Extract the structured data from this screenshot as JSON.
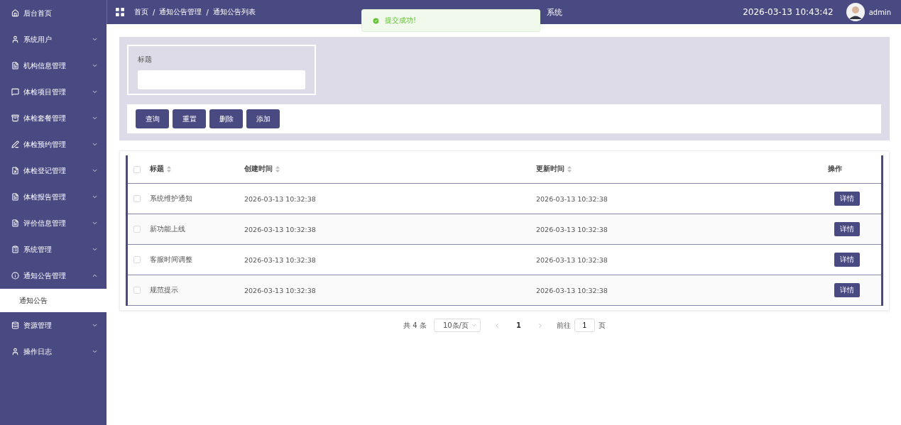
{
  "sidebar": {
    "items": [
      {
        "kind": "home",
        "label": "后台首页"
      },
      {
        "kind": "user",
        "label": "系统用户",
        "expanded": false
      },
      {
        "kind": "doc",
        "label": "机构信息管理",
        "expanded": false
      },
      {
        "kind": "chat",
        "label": "体检项目管理",
        "expanded": false
      },
      {
        "kind": "box",
        "label": "体检套餐管理",
        "expanded": false
      },
      {
        "kind": "pen",
        "label": "体检预约管理",
        "expanded": false
      },
      {
        "kind": "file",
        "label": "体检登记管理",
        "expanded": false
      },
      {
        "kind": "doc",
        "label": "体检报告管理",
        "expanded": false
      },
      {
        "kind": "doc",
        "label": "评价信息管理",
        "expanded": false
      },
      {
        "kind": "list",
        "label": "系统管理",
        "expanded": false
      },
      {
        "kind": "info",
        "label": "通知公告管理",
        "expanded": true,
        "children": [
          {
            "label": "通知公告",
            "selected": true
          }
        ]
      },
      {
        "kind": "db",
        "label": "资源管理",
        "expanded": false
      },
      {
        "kind": "user",
        "label": "操作日志",
        "expanded": false
      }
    ]
  },
  "header": {
    "breadcrumb": [
      "首页",
      "通知公告管理",
      "通知公告列表"
    ],
    "separator": "/",
    "title": "系统",
    "datetime": "2026-03-13 10:43:42",
    "username": "admin"
  },
  "toast": {
    "message": "提交成功!"
  },
  "filter": {
    "label": "标题"
  },
  "actions": [
    "查询",
    "重置",
    "删除",
    "添加"
  ],
  "table": {
    "all_checked": false,
    "columns": [
      {
        "label": "标题",
        "sortable": true
      },
      {
        "label": "创建时间",
        "sortable": true
      },
      {
        "label": "更新时间",
        "sortable": true
      },
      {
        "label": "操作",
        "sortable": false
      }
    ],
    "rows": [
      {
        "checked": false,
        "title": "系统维护通知",
        "created": "2026-03-13 10:32:38",
        "updated": "2026-03-13 10:32:38",
        "action": "详情"
      },
      {
        "checked": false,
        "title": "新功能上线",
        "created": "2026-03-13 10:32:38",
        "updated": "2026-03-13 10:32:38",
        "action": "详情"
      },
      {
        "checked": false,
        "title": "客服时间调整",
        "created": "2026-03-13 10:32:38",
        "updated": "2026-03-13 10:32:38",
        "action": "详情"
      },
      {
        "checked": false,
        "title": "规范提示",
        "created": "2026-03-13 10:32:38",
        "updated": "2026-03-13 10:32:38",
        "action": "详情"
      }
    ]
  },
  "pagination": {
    "total": "共 4 条",
    "page_size": "10条/页",
    "current": "1",
    "goto_label": "前往",
    "goto_value": "1",
    "unit": "页"
  }
}
